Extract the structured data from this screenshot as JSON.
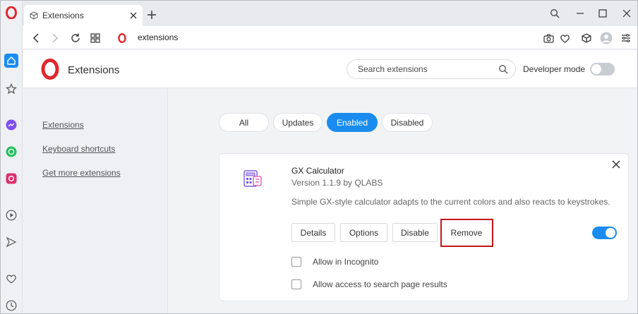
{
  "browser": {
    "tab": {
      "title": "Extensions"
    },
    "address": {
      "url": "extensions"
    }
  },
  "page": {
    "title": "Extensions",
    "search": {
      "placeholder": "Search extensions"
    },
    "developer_mode": {
      "label": "Developer mode",
      "enabled": false
    }
  },
  "nav": {
    "items": [
      {
        "label": "Extensions"
      },
      {
        "label": "Keyboard shortcuts"
      },
      {
        "label": "Get more extensions"
      }
    ]
  },
  "filters": {
    "items": [
      {
        "label": "All"
      },
      {
        "label": "Updates"
      },
      {
        "label": "Enabled"
      },
      {
        "label": "Disabled"
      }
    ],
    "active": "Enabled"
  },
  "extension": {
    "name": "GX Calculator",
    "version": "Version 1.1.9 by QLABS",
    "description": "Simple GX-style calculator adapts to the current colors and also reacts to keystrokes.",
    "buttons": {
      "details": "Details",
      "options": "Options",
      "disable": "Disable",
      "remove": "Remove"
    },
    "enabled": true,
    "allow_incognito": "Allow in Incognito",
    "allow_search": "Allow access to search page results"
  },
  "colors": {
    "accent": "#1a8cf0",
    "opera_red": "#e0282e",
    "highlight": "#c4161c"
  }
}
